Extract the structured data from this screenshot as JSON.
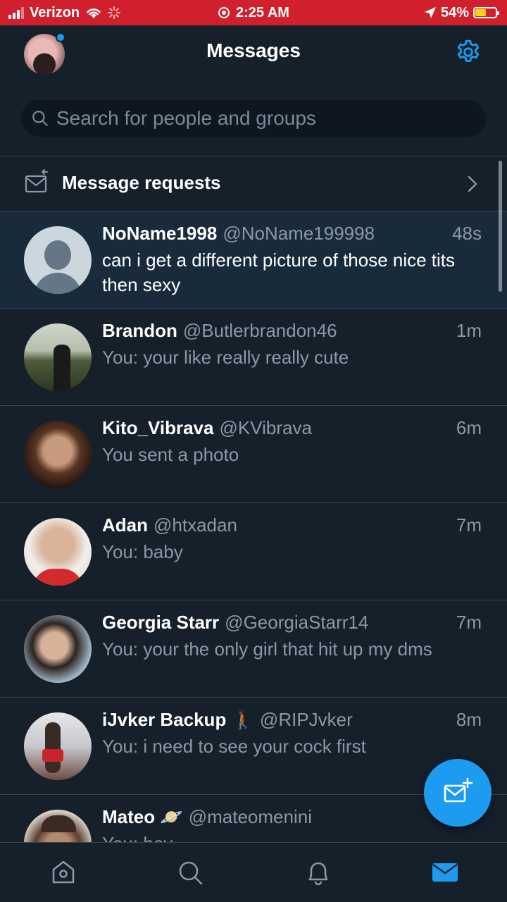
{
  "status_bar": {
    "carrier": "Verizon",
    "time": "2:25 AM",
    "battery": "54%",
    "battery_level": 0.54,
    "battery_color": "#ffd60a",
    "background": "#d0202e"
  },
  "header": {
    "title": "Messages",
    "settings_icon": "gear-icon",
    "accent_color": "#1d9bf0"
  },
  "search": {
    "placeholder": "Search for people and groups",
    "value": ""
  },
  "requests": {
    "label": "Message requests"
  },
  "conversations": [
    {
      "name": "NoName1998",
      "handle": "@NoName199998",
      "time": "48s",
      "preview": "can i get a different picture of those nice tits then sexy",
      "unread": true
    },
    {
      "name": "Brandon",
      "handle": "@Butlerbrandon46",
      "time": "1m",
      "preview": "You: your like really really cute"
    },
    {
      "name": "Kito_Vibrava",
      "handle": "@KVibrava",
      "time": "6m",
      "preview": "You sent a photo"
    },
    {
      "name": "Adan",
      "handle": "@htxadan",
      "time": "7m",
      "preview": "You: baby"
    },
    {
      "name": "Georgia Starr",
      "handle": "@GeorgiaStarr14",
      "time": "7m",
      "preview": "You: your the only girl that hit up my dms"
    },
    {
      "name": "iJvker Backup 🚶🏿",
      "handle": "@RIPJvker",
      "time": "8m",
      "preview": "You: i need to see your cock first"
    },
    {
      "name": "Mateo 🪐",
      "handle": "@mateomenini",
      "time": "",
      "preview": "You: hey"
    }
  ],
  "bottom_nav": [
    "home-icon",
    "search-icon",
    "bell-icon",
    "mail-icon"
  ],
  "fab_icon": "new-message-icon"
}
